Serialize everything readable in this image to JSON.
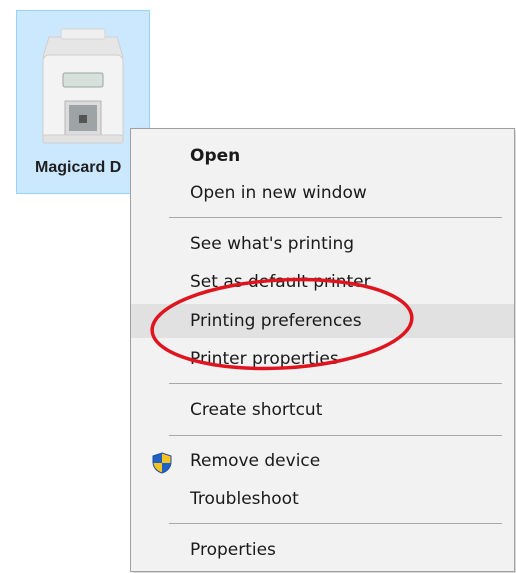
{
  "desktop_icon": {
    "label": "Magicard D",
    "icon": "card-printer-icon"
  },
  "context_menu": {
    "items": [
      {
        "label": "Open",
        "bold": true
      },
      {
        "label": "Open in new window"
      },
      {
        "label": "See what's printing"
      },
      {
        "label": "Set as default printer"
      },
      {
        "label": "Printing preferences",
        "highlighted": true
      },
      {
        "label": "Printer properties"
      },
      {
        "label": "Create shortcut"
      },
      {
        "label": "Remove device",
        "icon": "uac-shield-icon"
      },
      {
        "label": "Troubleshoot"
      },
      {
        "label": "Properties"
      }
    ]
  },
  "annotation": {
    "color": "#e0141e",
    "target": "Printing preferences"
  },
  "colors": {
    "menu_background": "#f2f2f2",
    "highlight": "#e1e1e1",
    "selection_tile": "#cce8ff"
  }
}
